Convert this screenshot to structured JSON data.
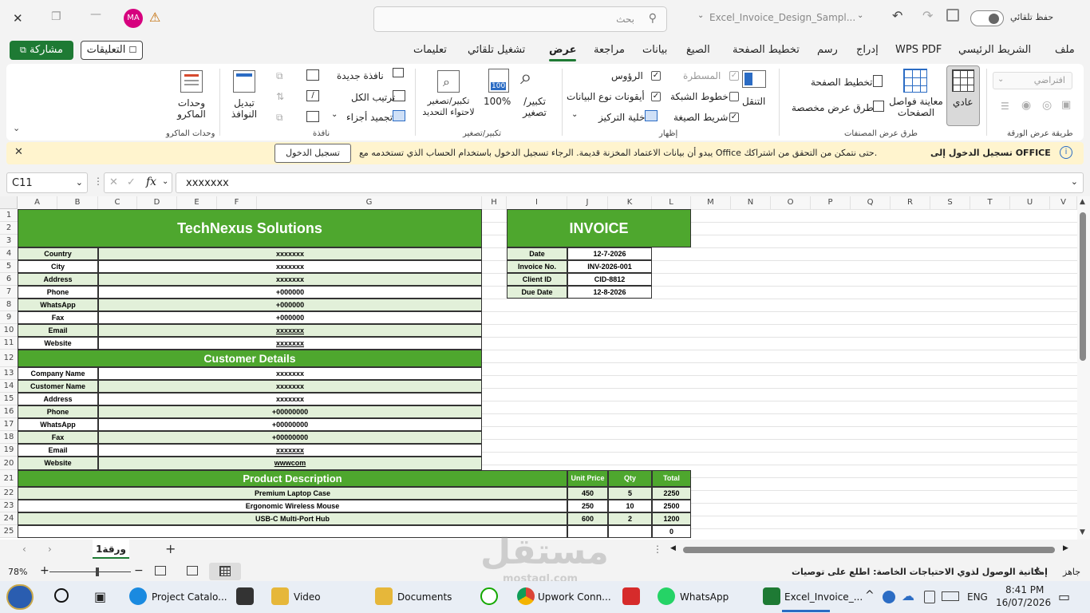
{
  "title_bar": {
    "avatar_initials": "MA",
    "search_placeholder": "بحث",
    "file_name": "Excel_Invoice_Design_Sampl...",
    "autosave_label": "حفظ تلقائي"
  },
  "menu": {
    "items": [
      "ملف",
      "الشريط الرئيسي",
      "WPS PDF",
      "إدراج",
      "رسم",
      "تخطيط الصفحة",
      "الصيغ",
      "بيانات",
      "مراجعة",
      "عرض",
      "تشغيل تلقائي",
      "تعليمات"
    ],
    "active": "عرض",
    "comments_label": "التعليقات",
    "share_label": "مشاركة"
  },
  "ribbon": {
    "sheet_view": {
      "dropdown": "افتراضي",
      "group": "طريقة عرض الورقة"
    },
    "workbook_views": {
      "normal": "عادي",
      "page_break": "معاينة فواصل الصفحات",
      "page_layout": "تخطيط الصفحة",
      "custom_views": "طرق عرض مخصصة",
      "group": "طرق عرض المصنفات"
    },
    "show": {
      "navigation": "التنقل",
      "ruler": "المسطرة",
      "gridlines": "خطوط الشبكة",
      "formula_bar": "شريط الصيغة",
      "headings": "الرؤوس",
      "data_type_icons": "أيقونات نوع البيانات",
      "focus_cell": "خلية التركيز",
      "group": "إظهار"
    },
    "zoom": {
      "zoom": "تكبير/تصغير",
      "zoom_100": "100%",
      "zoom_selection": "تكبير/تصغير لاحتواء التحديد",
      "group": "تكبير/تصغير"
    },
    "window": {
      "new_window": "نافذة جديدة",
      "arrange_all": "ترتيب الكل",
      "freeze_panes": "تجميد أجزاء",
      "switch_windows": "تبديل النوافذ",
      "group": "نافذة"
    },
    "macros": {
      "macros": "وحدات الماكرو",
      "group": "وحدات الماكرو"
    }
  },
  "message_bar": {
    "title": "تسجيل الدخول إلى OFFICE",
    "text": "يبدو أن بيانات الاعتماد المخزنة قديمة. الرجاء تسجيل الدخول باستخدام الحساب الذي تستخدمه مع Office حتى نتمكن من التحقق من اشتراكك.",
    "button": "تسجيل الدخول"
  },
  "formula_bar": {
    "name_box": "C11",
    "fx": "fx",
    "value": "xxxxxxx"
  },
  "columns": [
    "A",
    "B",
    "C",
    "D",
    "E",
    "F",
    "G",
    "H",
    "I",
    "J",
    "K",
    "L",
    "M",
    "N",
    "O",
    "P",
    "Q",
    "R",
    "S",
    "T",
    "U",
    "V"
  ],
  "rows": [
    "1",
    "2",
    "3",
    "4",
    "5",
    "6",
    "7",
    "8",
    "9",
    "10",
    "11",
    "12",
    "13",
    "14",
    "15",
    "16",
    "17",
    "18",
    "19",
    "20",
    "21",
    "22",
    "23",
    "24",
    "25"
  ],
  "invoice": {
    "company": "TechNexus Solutions",
    "company_rows": [
      {
        "label": "Country",
        "value": "xxxxxxx"
      },
      {
        "label": "City",
        "value": "xxxxxxx"
      },
      {
        "label": "Address",
        "value": "xxxxxxx"
      },
      {
        "label": "Phone",
        "value": "+000000"
      },
      {
        "label": "WhatsApp",
        "value": "+000000"
      },
      {
        "label": "Fax",
        "value": "+000000"
      },
      {
        "label": "Email",
        "value": "xxxxxxx"
      },
      {
        "label": "Website",
        "value": "xxxxxxx"
      }
    ],
    "customer_title": "Customer Details",
    "customer_rows": [
      {
        "label": "Company Name",
        "value": "xxxxxxx"
      },
      {
        "label": "Customer Name",
        "value": "xxxxxxx"
      },
      {
        "label": "Address",
        "value": "xxxxxxx"
      },
      {
        "label": "Phone",
        "value": "+00000000"
      },
      {
        "label": "WhatsApp",
        "value": "+00000000"
      },
      {
        "label": "Fax",
        "value": "+00000000"
      },
      {
        "label": "Email",
        "value": "xxxxxxx"
      },
      {
        "label": "Website",
        "value": "wwwcom"
      }
    ],
    "invoice_title": "INVOICE",
    "meta": [
      {
        "label": "Date",
        "value": "12-7-2026"
      },
      {
        "label": "Invoice No.",
        "value": "INV-2026-001"
      },
      {
        "label": "Client ID",
        "value": "CID-8812"
      },
      {
        "label": "Due Date",
        "value": "12-8-2026"
      }
    ],
    "product_header": {
      "desc": "Product Description",
      "price": "Unit Price",
      "qty": "Qty",
      "total": "Total"
    },
    "products": [
      {
        "desc": "Premium Laptop Case",
        "price": "450",
        "qty": "5",
        "total": "2250"
      },
      {
        "desc": "Ergonomic Wireless Mouse",
        "price": "250",
        "qty": "10",
        "total": "2500"
      },
      {
        "desc": "USB-C Multi-Port Hub",
        "price": "600",
        "qty": "2",
        "total": "1200"
      },
      {
        "desc": "",
        "price": "",
        "qty": "",
        "total": "0"
      }
    ]
  },
  "sheet_tab": "ورقة1",
  "status": {
    "zoom": "78%",
    "accessibility": "إمكانية الوصول لذوي الاحتياجات الخاصة: اطلع على توصيات",
    "ready": "جاهز"
  },
  "taskbar": {
    "items": [
      "Project Catalo...",
      "Video",
      "Documents",
      "Upwork Conn...",
      "WhatsApp",
      "Excel_Invoice_..."
    ],
    "lang": "ENG",
    "time": "8:41 PM",
    "date": "16/07/2026"
  },
  "watermark": {
    "arabic": "مستقل",
    "latin": "mostaql.com"
  }
}
